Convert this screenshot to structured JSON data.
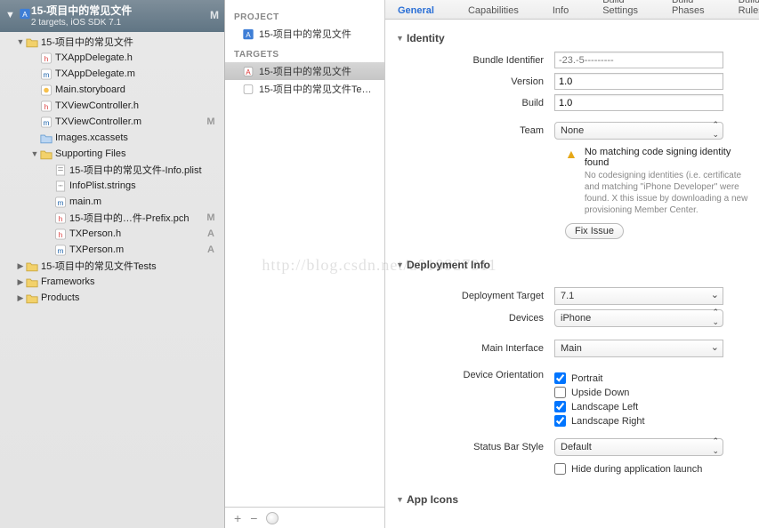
{
  "project": {
    "title": "15-项目中的常见文件",
    "subtitle": "2 targets, iOS SDK 7.1",
    "m": "M"
  },
  "tree": [
    {
      "d": 0,
      "tw": "▼",
      "ico": "folder",
      "lbl": "15-项目中的常见文件",
      "b": ""
    },
    {
      "d": 1,
      "tw": "",
      "ico": "h",
      "lbl": "TXAppDelegate.h",
      "b": ""
    },
    {
      "d": 1,
      "tw": "",
      "ico": "m",
      "lbl": "TXAppDelegate.m",
      "b": ""
    },
    {
      "d": 1,
      "tw": "",
      "ico": "sb",
      "lbl": "Main.storyboard",
      "b": ""
    },
    {
      "d": 1,
      "tw": "",
      "ico": "h",
      "lbl": "TXViewController.h",
      "b": ""
    },
    {
      "d": 1,
      "tw": "",
      "ico": "m",
      "lbl": "TXViewController.m",
      "b": "M"
    },
    {
      "d": 1,
      "tw": "",
      "ico": "xa",
      "lbl": "Images.xcassets",
      "b": ""
    },
    {
      "d": 1,
      "tw": "▼",
      "ico": "folder",
      "lbl": "Supporting Files",
      "b": ""
    },
    {
      "d": 2,
      "tw": "",
      "ico": "plist",
      "lbl": "15-项目中的常见文件-Info.plist",
      "b": ""
    },
    {
      "d": 2,
      "tw": "",
      "ico": "str",
      "lbl": "InfoPlist.strings",
      "b": ""
    },
    {
      "d": 2,
      "tw": "",
      "ico": "m",
      "lbl": "main.m",
      "b": ""
    },
    {
      "d": 2,
      "tw": "",
      "ico": "h",
      "lbl": "15-项目中的…件-Prefix.pch",
      "b": "M"
    },
    {
      "d": 2,
      "tw": "",
      "ico": "h",
      "lbl": "TXPerson.h",
      "b": "A"
    },
    {
      "d": 2,
      "tw": "",
      "ico": "m",
      "lbl": "TXPerson.m",
      "b": "A"
    },
    {
      "d": 0,
      "tw": "▶",
      "ico": "folder",
      "lbl": "15-项目中的常见文件Tests",
      "b": ""
    },
    {
      "d": 0,
      "tw": "▶",
      "ico": "folder",
      "lbl": "Frameworks",
      "b": ""
    },
    {
      "d": 0,
      "tw": "▶",
      "ico": "folder",
      "lbl": "Products",
      "b": ""
    }
  ],
  "tabs": [
    "General",
    "Capabilities",
    "Info",
    "Build Settings",
    "Build Phases",
    "Build Rules"
  ],
  "activeTab": "General",
  "mid": {
    "project_h": "PROJECT",
    "project_item": "15-项目中的常见文件",
    "targets_h": "TARGETS",
    "targets": [
      "15-项目中的常见文件",
      "15-项目中的常见文件Te…"
    ],
    "plus": "+",
    "minus": "−"
  },
  "identity": {
    "head": "Identity",
    "bundle_lbl": "Bundle Identifier",
    "bundle_ph": "-23.-5---------",
    "version_lbl": "Version",
    "version": "1.0",
    "build_lbl": "Build",
    "build": "1.0",
    "team_lbl": "Team",
    "team": "None",
    "warn_t": "No matching code signing identity found",
    "warn_s": "No codesigning identities (i.e. certificate and matching \"iPhone Developer\" were found.  X this issue by downloading a new provisioning Member Center.",
    "fix": "Fix Issue"
  },
  "deploy": {
    "head": "Deployment Info",
    "target_lbl": "Deployment Target",
    "target": "7.1",
    "devices_lbl": "Devices",
    "devices": "iPhone",
    "main_lbl": "Main Interface",
    "main": "Main",
    "orient_lbl": "Device Orientation",
    "o1": "Portrait",
    "o2": "Upside Down",
    "o3": "Landscape Left",
    "o4": "Landscape Right",
    "sbs_lbl": "Status Bar Style",
    "sbs": "Default",
    "hide": "Hide during application launch"
  },
  "appicons": {
    "head": "App Icons"
  },
  "watermark": "http://blog.csdn.net/u010927311"
}
